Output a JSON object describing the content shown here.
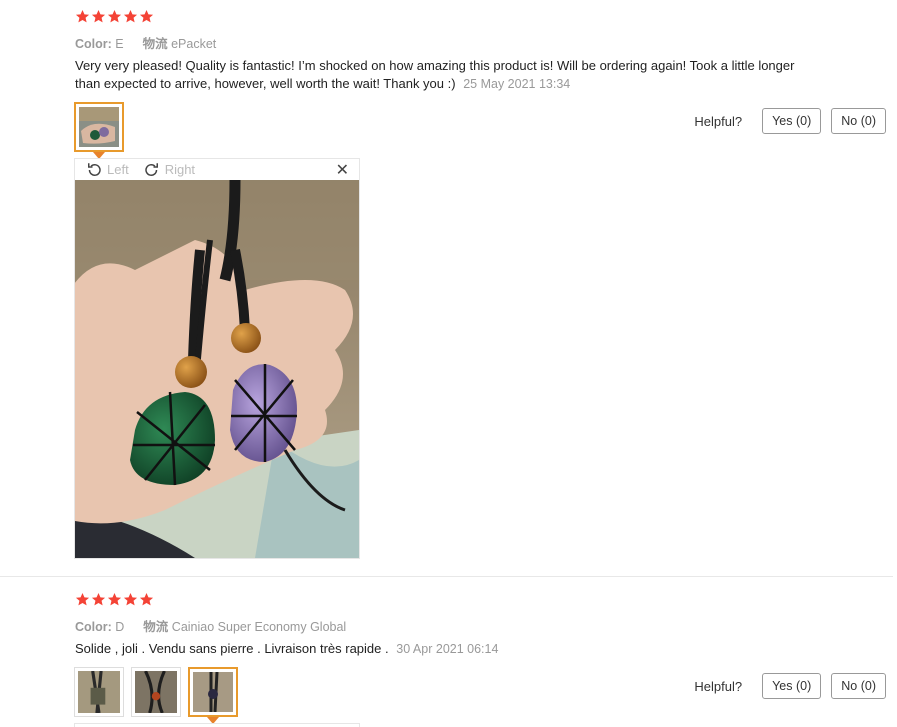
{
  "reviews": [
    {
      "rating": 5,
      "color_label": "Color:",
      "color_value": "E",
      "shipping_label": "物流",
      "shipping_value": "ePacket",
      "text": "Very very pleased! Quality is fantastic! I’m shocked on how amazing this product is! Will be ordering again! Took a little longer than expected to arrive, however, well worth the wait! Thank you :)",
      "date": "25 May 2021 13:34",
      "helpful_label": "Helpful?",
      "yes_label": "Yes (0)",
      "no_label": "No (0)",
      "viewer": {
        "rotate_left": "Left",
        "rotate_right": "Right",
        "close": "✕"
      }
    },
    {
      "rating": 5,
      "color_label": "Color:",
      "color_value": "D",
      "shipping_label": "物流",
      "shipping_value": "Cainiao Super Economy Global",
      "text": "Solide , joli . Vendu sans pierre . Livraison très rapide .",
      "date": "30 Apr 2021 06:14",
      "helpful_label": "Helpful?",
      "yes_label": "Yes (0)",
      "no_label": "No (0)"
    }
  ],
  "colors": {
    "star": "#f44336",
    "active_thumb": "#e89a2c",
    "muted": "#999999"
  },
  "icons": [
    "star-icon",
    "rotate-left-icon",
    "rotate-right-icon",
    "close-icon"
  ]
}
